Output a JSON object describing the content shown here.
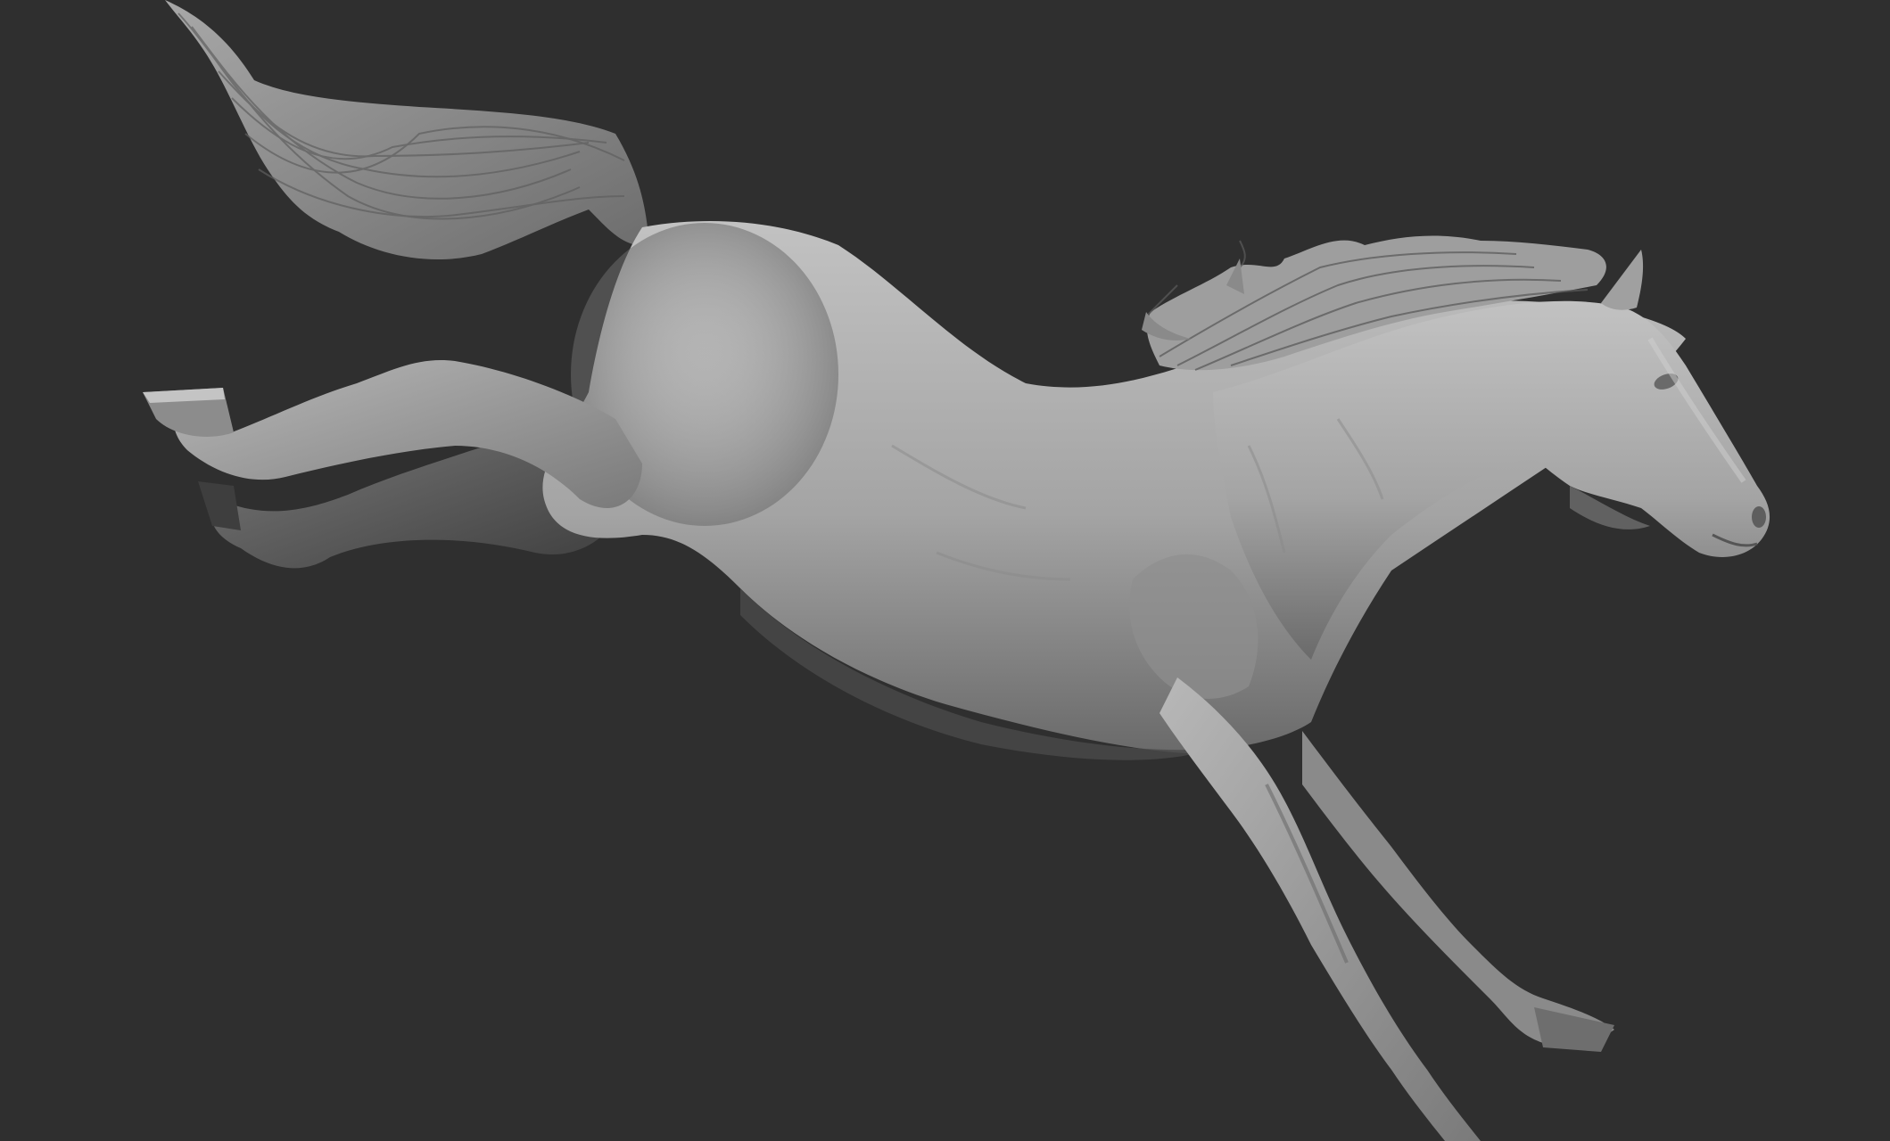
{
  "scene": {
    "subject": "sculpted-horse-model",
    "material": "matte-gray-clay",
    "pose": "bucking-midair"
  },
  "colors": {
    "background": "#2f2f2f",
    "clay_light": "#bdbdbd",
    "clay_mid": "#9a9a9a",
    "clay_dark": "#5a5a5a",
    "clay_shadow": "#3a3a3a"
  }
}
